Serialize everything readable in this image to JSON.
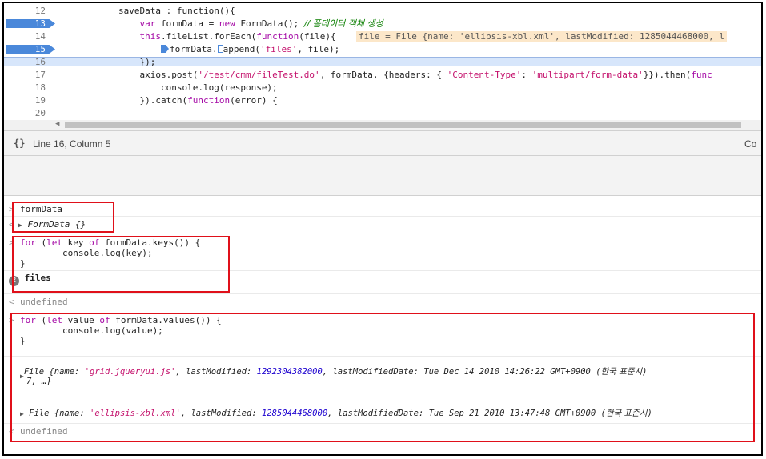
{
  "editor": {
    "lines": [
      {
        "num": "12",
        "breakpoint": false,
        "indent": "",
        "parts": [
          {
            "t": "saveData : function(){",
            "c": ""
          }
        ]
      },
      {
        "num": "13",
        "breakpoint": true,
        "indent": "    ",
        "parts": [
          {
            "t": "var",
            "c": "kw"
          },
          {
            "t": " formData = ",
            "c": ""
          },
          {
            "t": "new",
            "c": "kw"
          },
          {
            "t": " FormData(); ",
            "c": ""
          },
          {
            "t": "// 폼데이터 객체 생성",
            "c": "cmt"
          }
        ]
      },
      {
        "num": "14",
        "breakpoint": false,
        "indent": "    ",
        "parts": [
          {
            "t": "this",
            "c": "kw"
          },
          {
            "t": ".fileList.forEach(",
            "c": ""
          },
          {
            "t": "function",
            "c": "kw"
          },
          {
            "t": "(file){",
            "c": ""
          }
        ]
      },
      {
        "num": "15",
        "breakpoint": true,
        "indent": "        ",
        "parts": [
          {
            "t": "formData.",
            "c": ""
          },
          {
            "t": "append(",
            "c": ""
          },
          {
            "t": "'files'",
            "c": "str"
          },
          {
            "t": ", file);",
            "c": ""
          }
        ]
      },
      {
        "num": "16",
        "breakpoint": false,
        "indent": "    ",
        "parts": [
          {
            "t": "});",
            "c": ""
          }
        ]
      },
      {
        "num": "17",
        "breakpoint": false,
        "indent": "    ",
        "parts": [
          {
            "t": "axios.post(",
            "c": ""
          },
          {
            "t": "'/test/cmm/fileTest.do'",
            "c": "str"
          },
          {
            "t": ", formData, {headers: { ",
            "c": ""
          },
          {
            "t": "'Content-Type'",
            "c": "str"
          },
          {
            "t": ": ",
            "c": ""
          },
          {
            "t": "'multipart/form-data'",
            "c": "str"
          },
          {
            "t": "}}).then(",
            "c": ""
          },
          {
            "t": "func",
            "c": "kw"
          }
        ]
      },
      {
        "num": "18",
        "breakpoint": false,
        "indent": "        ",
        "parts": [
          {
            "t": "console.log(response);",
            "c": ""
          }
        ]
      },
      {
        "num": "19",
        "breakpoint": false,
        "indent": "    ",
        "parts": [
          {
            "t": "}).catch(",
            "c": ""
          },
          {
            "t": "function",
            "c": "kw"
          },
          {
            "t": "(error) {",
            "c": ""
          }
        ]
      },
      {
        "num": "20",
        "breakpoint": false,
        "indent": "",
        "parts": []
      }
    ],
    "tooltip": "file = File {name: 'ellipsis-xbl.xml', lastModified: 1285044468000, l"
  },
  "status": {
    "braces": "{}",
    "position": "Line 16, Column 5",
    "right_text": "Co"
  },
  "console": {
    "prompt_in": ">",
    "prompt_out": "<",
    "entry1": {
      "input": "formData",
      "output": "FormData {}"
    },
    "entry2": {
      "line1a": "for",
      "line1b": " (",
      "line1c": "let",
      "line1d": " key ",
      "line1e": "of",
      "line1f": " formData.keys()) {",
      "line2": "        console.log(key);",
      "line3": "}",
      "repeat_count": "2",
      "log": "files",
      "result": "undefined"
    },
    "entry3": {
      "line1a": "for",
      "line1b": " (",
      "line1c": "let",
      "line1d": " value ",
      "line1e": "of",
      "line1f": " formData.values()) {",
      "line2": "        console.log(value);",
      "line3": "}",
      "file1": {
        "prefix": "File {name: ",
        "name": "'grid.jqueryui.js'",
        "lm_label": ", lastModified: ",
        "lm": "1292304382000",
        "lmd_label": ", lastModifiedDate: Tue Dec 14 2010 14:26:22 GMT+0900 (",
        "tz": "한국 표준시",
        "suffix": ")",
        "wrap": "7, …}"
      },
      "file2": {
        "prefix": "File {name: ",
        "name": "'ellipsis-xbl.xml'",
        "lm_label": ", lastModified: ",
        "lm": "1285044468000",
        "lmd_label": ", lastModifiedDate: Tue Sep 21 2010 13:47:48 GMT+0900 (",
        "tz": "한국 표준시",
        "suffix": ")"
      },
      "result": "undefined"
    }
  },
  "colors": {
    "breakpoint": "#4a88da",
    "annotation_box": "#e0101a",
    "keyword": "#a50aa6",
    "string": "#c4116c",
    "number": "#1c00cf",
    "comment": "#0a7f00"
  }
}
